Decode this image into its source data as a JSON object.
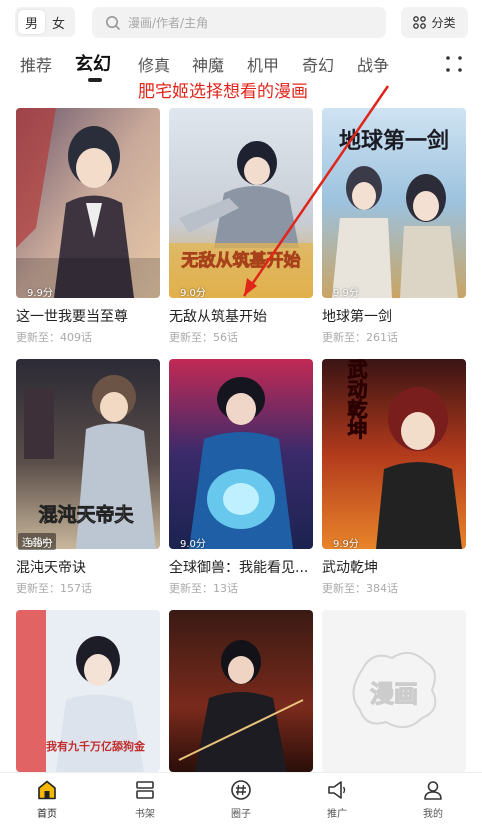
{
  "header": {
    "gender": {
      "male": "男",
      "female": "女"
    },
    "search": {
      "placeholder": "漫画/作者/主角"
    },
    "categories_label": "分类"
  },
  "tabs": [
    {
      "label": "推荐"
    },
    {
      "label": "玄幻"
    },
    {
      "label": "修真"
    },
    {
      "label": "神魔"
    },
    {
      "label": "机甲"
    },
    {
      "label": "奇幻"
    },
    {
      "label": "战争"
    }
  ],
  "annotation": "肥宅姬选择想看的漫画",
  "comics": [
    {
      "title": "这一世我要当至尊",
      "score": "9.9分",
      "update": "更新至：409话"
    },
    {
      "title": "无敌从筑基开始",
      "score": "9.0分",
      "update": "更新至：56话"
    },
    {
      "title": "地球第一剑",
      "score": "9.9分",
      "update": "更新至：261话"
    },
    {
      "title": "混沌天帝诀",
      "score": "9.9分",
      "update": "更新至：157话",
      "badge": "连载中"
    },
    {
      "title": "全球御兽：我能看见...",
      "score": "9.0分",
      "update": "更新至：13话"
    },
    {
      "title": "武动乾坤",
      "score": "9.9分",
      "update": "更新至：384话"
    }
  ],
  "cover_text": {
    "c2": "无敌从筑基开始",
    "c3": "地球第一剑",
    "c4": "混沌天帝夫",
    "c6": "武动乾坤",
    "c7": "我有九千万亿舔狗金",
    "c9": "漫画"
  },
  "nav": [
    {
      "label": "首页"
    },
    {
      "label": "书架"
    },
    {
      "label": "圈子"
    },
    {
      "label": "推广"
    },
    {
      "label": "我的"
    }
  ],
  "colors": {
    "accent": "#e0251b",
    "nav_active": "#f5b700"
  }
}
